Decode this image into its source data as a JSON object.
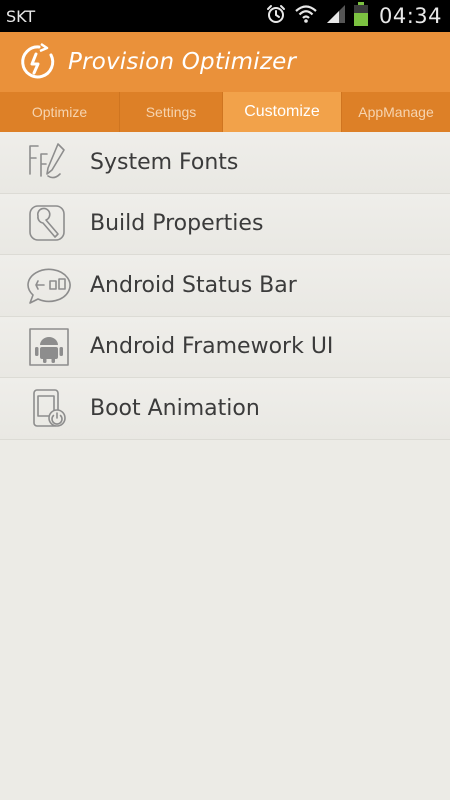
{
  "status_bar": {
    "carrier": "SKT",
    "time": "04:34",
    "icons": [
      "alarm-icon",
      "wifi-icon",
      "signal-icon",
      "battery-icon"
    ]
  },
  "app": {
    "title": "Provision Optimizer",
    "accent_color": "#ea913a"
  },
  "tabs": [
    {
      "label": "Optimize",
      "selected": false
    },
    {
      "label": "Settings",
      "selected": false
    },
    {
      "label": "Customize",
      "selected": true
    },
    {
      "label": "AppManage",
      "selected": false
    }
  ],
  "menu": [
    {
      "label": "System Fonts",
      "icon": "fonts-icon"
    },
    {
      "label": "Build Properties",
      "icon": "wrench-icon"
    },
    {
      "label": "Android Status Bar",
      "icon": "status-bar-icon"
    },
    {
      "label": "Android Framework UI",
      "icon": "android-icon"
    },
    {
      "label": "Boot Animation",
      "icon": "boot-animation-icon"
    }
  ]
}
